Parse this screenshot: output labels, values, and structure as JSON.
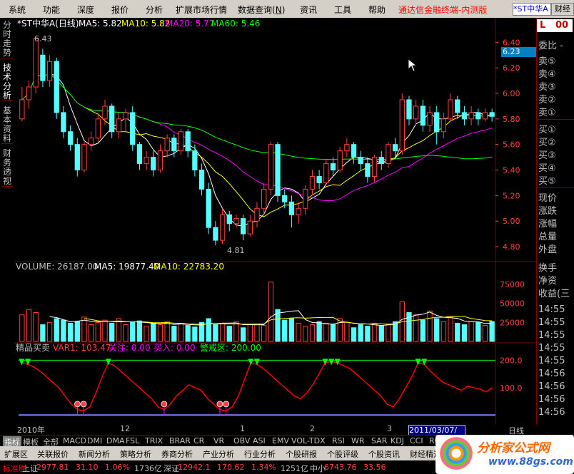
{
  "menu": [
    "系统",
    "功能",
    "深度",
    "报价",
    "分析",
    "扩展市场行情",
    "数据查询",
    "资讯",
    "工具",
    "帮助"
  ],
  "menu_shortcut": "N",
  "app_title": "通达信金融终端-内测版",
  "stock_box": "*ST中华A",
  "stock_box_btn": "财经",
  "left_tabs": [
    "分时走势",
    "技术分析",
    "基本资料",
    "财务透视"
  ],
  "price_header": {
    "name": "*ST中华A(日线)",
    "ma5": "MA5: 5.82",
    "ma10": "MA10: 5.82",
    "ma20": "MA20: 5.77",
    "ma60": "MA60: 5.46",
    "ma5_color": "#ffffff",
    "ma10_color": "#ffff00",
    "ma20_color": "#ff00ff",
    "ma60_color": "#00ff00"
  },
  "price_axis": [
    "6.40",
    "6.20",
    "6.00",
    "5.80",
    "5.60",
    "5.40",
    "5.20",
    "5.00",
    "4.80"
  ],
  "current_price_tag": "6.23",
  "high_label": "6.43",
  "low_label": "4.81",
  "volume_header": {
    "vol": "VOLUME: 26187.00",
    "ma5": "MA5: 19877.40",
    "ma10": "MA10: 22783.20"
  },
  "volume_axis": [
    "75000",
    "50000",
    "25000"
  ],
  "indicator_header": {
    "name": "精品买卖",
    "var1": "VAR1: 103.47",
    "guanzhu": "关注: 0.00",
    "mairu": "买入: 0.00",
    "jingjie": "警戒区: 200.00"
  },
  "indicator_axis": [
    "200.0",
    "100.0"
  ],
  "right_panel": {
    "weibi": "委比",
    "weibi_val": "-",
    "sells": [
      "卖⑤",
      "卖④",
      "卖③",
      "卖②",
      "卖①"
    ],
    "buys": [
      "买①",
      "买②",
      "买③",
      "买④",
      "买⑤"
    ],
    "stats": [
      "现价",
      "涨跌",
      "涨幅",
      "总量",
      "外盘",
      "换手",
      "净资",
      "收益(三"
    ],
    "times": [
      "14:55",
      "14:55",
      "14:55",
      "14:55",
      "14:55",
      "14:56",
      "14:56",
      "14:56",
      "14:56",
      "14:56",
      "14:56",
      "14:56",
      "14:56"
    ],
    "top_l": "L",
    "top_num": "00"
  },
  "date_labels": [
    "2010年",
    "12",
    "1",
    "2",
    "3"
  ],
  "date_cursor": "2011/03/07/一",
  "period": "日线",
  "tabs2": [
    "指标",
    "模板",
    "全部",
    "MACD",
    "DMI",
    "DMA",
    "FSL",
    "TRIX",
    "BRAR",
    "CR",
    "VR",
    "OBV",
    "ASI",
    "EMV",
    "VOL-TDX",
    "RSI",
    "WR",
    "SAR",
    "KDJ",
    "CCI",
    "ROC"
  ],
  "tabs3": [
    "扩展区",
    "关联报价",
    "新闻分析",
    "策略分析",
    "券商分析",
    "产业分析",
    "行业分析",
    "个股研报",
    "个股评级",
    "个股资讯",
    "财经精选"
  ],
  "statusbar": [
    {
      "t": "标准胜",
      "c": "#ff0000"
    },
    {
      "t": "上证",
      "c": "#c0c0c0"
    },
    {
      "t": "2977.81",
      "c": "#ff4040"
    },
    {
      "t": "31.10",
      "c": "#ff4040"
    },
    {
      "t": "1.06%",
      "c": "#ff4040"
    },
    {
      "t": "1736亿",
      "c": "#c0c0c0"
    },
    {
      "t": "深证",
      "c": "#c0c0c0"
    },
    {
      "t": "12942.1",
      "c": "#ff4040"
    },
    {
      "t": "170.62",
      "c": "#ff4040"
    },
    {
      "t": "1.34%",
      "c": "#ff4040"
    },
    {
      "t": "1251亿",
      "c": "#c0c0c0"
    },
    {
      "t": "中小",
      "c": "#c0c0c0"
    },
    {
      "t": "6743.76",
      "c": "#ff4040"
    },
    {
      "t": "33.56",
      "c": "#ff4040"
    }
  ],
  "logo": {
    "title": "分析家公式网",
    "url": "www.88gs.com"
  },
  "chart_data": {
    "type": "candlestick",
    "price_ylim": [
      4.75,
      6.48
    ],
    "candles": [
      [
        5.8,
        5.95,
        5.78,
        6.05
      ],
      [
        5.95,
        6.05,
        5.88,
        6.1
      ],
      [
        6.05,
        6.43,
        6.0,
        6.43
      ],
      [
        6.3,
        6.1,
        6.05,
        6.35
      ],
      [
        6.1,
        6.25,
        6.05,
        6.3
      ],
      [
        6.25,
        5.85,
        5.8,
        6.28
      ],
      [
        5.85,
        5.7,
        5.65,
        5.9
      ],
      [
        5.7,
        5.6,
        5.55,
        5.75
      ],
      [
        5.6,
        5.4,
        5.35,
        5.65
      ],
      [
        5.4,
        5.6,
        5.38,
        5.62
      ],
      [
        5.6,
        5.65,
        5.55,
        5.7
      ],
      [
        5.65,
        5.8,
        5.62,
        5.85
      ],
      [
        5.8,
        5.9,
        5.75,
        5.95
      ],
      [
        5.9,
        5.7,
        5.65,
        5.92
      ],
      [
        5.7,
        5.8,
        5.65,
        5.85
      ],
      [
        5.8,
        5.85,
        5.7,
        5.88
      ],
      [
        5.85,
        5.6,
        5.55,
        5.9
      ],
      [
        5.6,
        5.45,
        5.4,
        5.62
      ],
      [
        5.45,
        5.5,
        5.4,
        5.55
      ],
      [
        5.5,
        5.4,
        5.35,
        5.55
      ],
      [
        5.4,
        5.55,
        5.38,
        5.6
      ],
      [
        5.55,
        5.65,
        5.5,
        5.68
      ],
      [
        5.65,
        5.55,
        5.5,
        5.68
      ],
      [
        5.55,
        5.7,
        5.52,
        5.72
      ],
      [
        5.7,
        5.55,
        5.5,
        5.72
      ],
      [
        5.55,
        5.4,
        5.35,
        5.6
      ],
      [
        5.4,
        5.25,
        5.2,
        5.45
      ],
      [
        5.25,
        4.95,
        4.9,
        5.3
      ],
      [
        4.95,
        4.85,
        4.81,
        5.0
      ],
      [
        4.85,
        5.05,
        4.82,
        5.1
      ],
      [
        5.05,
        4.98,
        4.92,
        5.08
      ],
      [
        4.98,
        5.02,
        4.95,
        5.05
      ],
      [
        5.02,
        4.9,
        4.85,
        5.05
      ],
      [
        4.9,
        5.0,
        4.88,
        5.05
      ],
      [
        5.0,
        5.1,
        4.95,
        5.15
      ],
      [
        5.1,
        5.25,
        5.05,
        5.3
      ],
      [
        5.25,
        5.6,
        5.2,
        5.62
      ],
      [
        5.6,
        5.2,
        5.15,
        5.62
      ],
      [
        5.2,
        5.15,
        5.1,
        5.25
      ],
      [
        5.15,
        5.05,
        4.95,
        5.2
      ],
      [
        5.05,
        5.1,
        4.98,
        5.15
      ],
      [
        5.1,
        5.25,
        5.05,
        5.28
      ],
      [
        5.25,
        5.35,
        5.2,
        5.4
      ],
      [
        5.35,
        5.3,
        5.25,
        5.4
      ],
      [
        5.3,
        5.45,
        5.28,
        5.48
      ],
      [
        5.45,
        5.4,
        5.35,
        5.5
      ],
      [
        5.4,
        5.55,
        5.38,
        5.58
      ],
      [
        5.55,
        5.6,
        5.5,
        5.65
      ],
      [
        5.6,
        5.5,
        5.45,
        5.62
      ],
      [
        5.5,
        5.45,
        5.4,
        5.55
      ],
      [
        5.45,
        5.35,
        5.3,
        5.5
      ],
      [
        5.35,
        5.5,
        5.3,
        5.52
      ],
      [
        5.5,
        5.45,
        5.4,
        5.55
      ],
      [
        5.45,
        5.6,
        5.42,
        5.62
      ],
      [
        5.6,
        5.55,
        5.5,
        5.65
      ],
      [
        5.55,
        5.95,
        5.52,
        6.0
      ],
      [
        5.95,
        5.8,
        5.75,
        5.98
      ],
      [
        5.8,
        5.9,
        5.75,
        5.95
      ],
      [
        5.9,
        5.75,
        5.7,
        5.95
      ],
      [
        5.75,
        5.85,
        5.7,
        5.9
      ],
      [
        5.85,
        5.7,
        5.6,
        5.9
      ],
      [
        5.7,
        5.8,
        5.65,
        5.85
      ],
      [
        5.8,
        5.95,
        5.78,
        6.0
      ],
      [
        5.95,
        5.85,
        5.8,
        5.98
      ],
      [
        5.85,
        5.8,
        5.75,
        5.9
      ],
      [
        5.8,
        5.85,
        5.75,
        5.9
      ],
      [
        5.85,
        5.8,
        5.75,
        5.88
      ],
      [
        5.8,
        5.85,
        5.78,
        5.88
      ],
      [
        5.85,
        5.82,
        5.78,
        5.88
      ]
    ],
    "volumes": [
      35000,
      42000,
      38000,
      22000,
      25000,
      30000,
      28000,
      24000,
      26000,
      32000,
      22000,
      25000,
      28000,
      24000,
      30000,
      22000,
      25000,
      27000,
      20000,
      24000,
      22000,
      26000,
      20000,
      23000,
      21000,
      19000,
      25000,
      30000,
      22000,
      24000,
      20000,
      26000,
      18000,
      22000,
      23000,
      21000,
      78000,
      42000,
      28000,
      30000,
      24000,
      20000,
      22000,
      26000,
      24000,
      22000,
      30000,
      25000,
      18000,
      22000,
      20000,
      24000,
      21000,
      22000,
      26000,
      52000,
      38000,
      35000,
      28000,
      40000,
      30000,
      26000,
      32000,
      24000,
      22000,
      26000,
      25000,
      21000,
      26187
    ],
    "volume_ylim": [
      0,
      90000
    ],
    "indicator": [
      190,
      185,
      175,
      160,
      140,
      120,
      100,
      70,
      40,
      20,
      15,
      30,
      80,
      140,
      190,
      180,
      160,
      140,
      120,
      100,
      80,
      60,
      30,
      20,
      40,
      70,
      90,
      110,
      100,
      90,
      60,
      40,
      20,
      15,
      30,
      70,
      130,
      190,
      185,
      170,
      150,
      130,
      110,
      90,
      70,
      60,
      80,
      110,
      150,
      190,
      195,
      190,
      180,
      170,
      150,
      130,
      110,
      90,
      70,
      40,
      30,
      60,
      100,
      140,
      190,
      185,
      160,
      140,
      120,
      110,
      100,
      90,
      105,
      100,
      95,
      85,
      100
    ],
    "indicator_ylim": [
      -20,
      240
    ]
  }
}
